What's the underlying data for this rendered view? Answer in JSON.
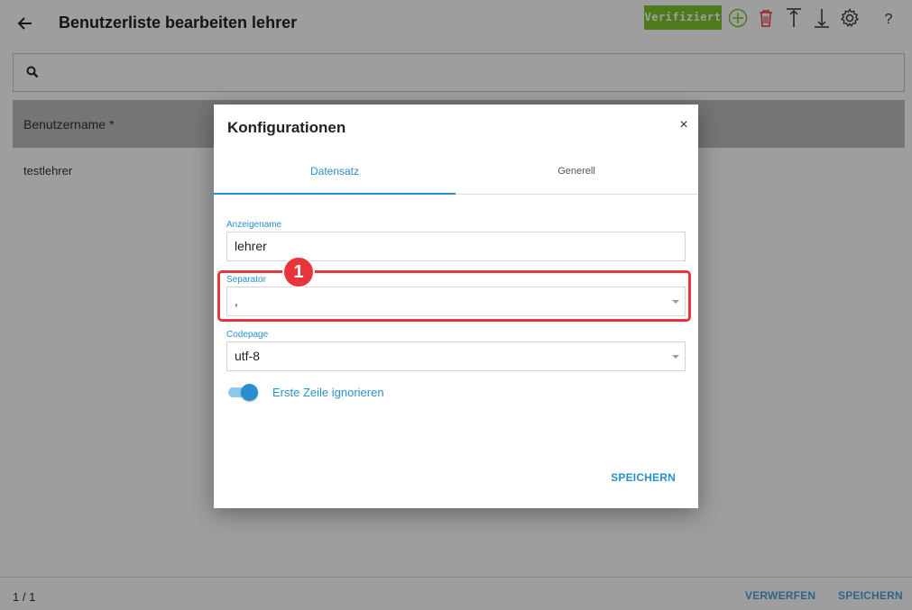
{
  "header": {
    "back_icon": "arrow-left-icon",
    "title": "Benutzerliste bearbeiten lehrer",
    "verified_label": "Verifiziert",
    "toolbar_icons": [
      "add-circle-icon",
      "trash-icon",
      "upload-icon",
      "download-icon",
      "gear-icon",
      "help-icon"
    ],
    "help_label": "?"
  },
  "search": {
    "icon": "search-icon",
    "value": ""
  },
  "table": {
    "columns": [
      "Benutzername *"
    ],
    "rows": [
      [
        "testlehrer"
      ]
    ]
  },
  "footer": {
    "pager": "1 / 1",
    "discard_label": "VERWERFEN",
    "save_label": "SPEICHERN"
  },
  "dialog": {
    "title": "Konfigurationen",
    "close_label": "×",
    "tabs": [
      {
        "label": "Datensatz",
        "active": true
      },
      {
        "label": "Generell",
        "active": false
      }
    ],
    "fields": {
      "display_name": {
        "label": "Anzeigename",
        "value": "lehrer"
      },
      "separator": {
        "label": "Separator",
        "value": ","
      },
      "codepage": {
        "label": "Codepage",
        "value": "utf-8"
      }
    },
    "skip_first_row": {
      "label": "Erste Zeile ignorieren",
      "checked": true
    },
    "save_label": "SPEICHERN"
  },
  "annotation": {
    "step": "1",
    "color": "#e8353b"
  },
  "colors": {
    "accent": "#2a8fce",
    "verified": "#7cc62a",
    "add": "#7cc62a",
    "delete": "#e8353b"
  }
}
